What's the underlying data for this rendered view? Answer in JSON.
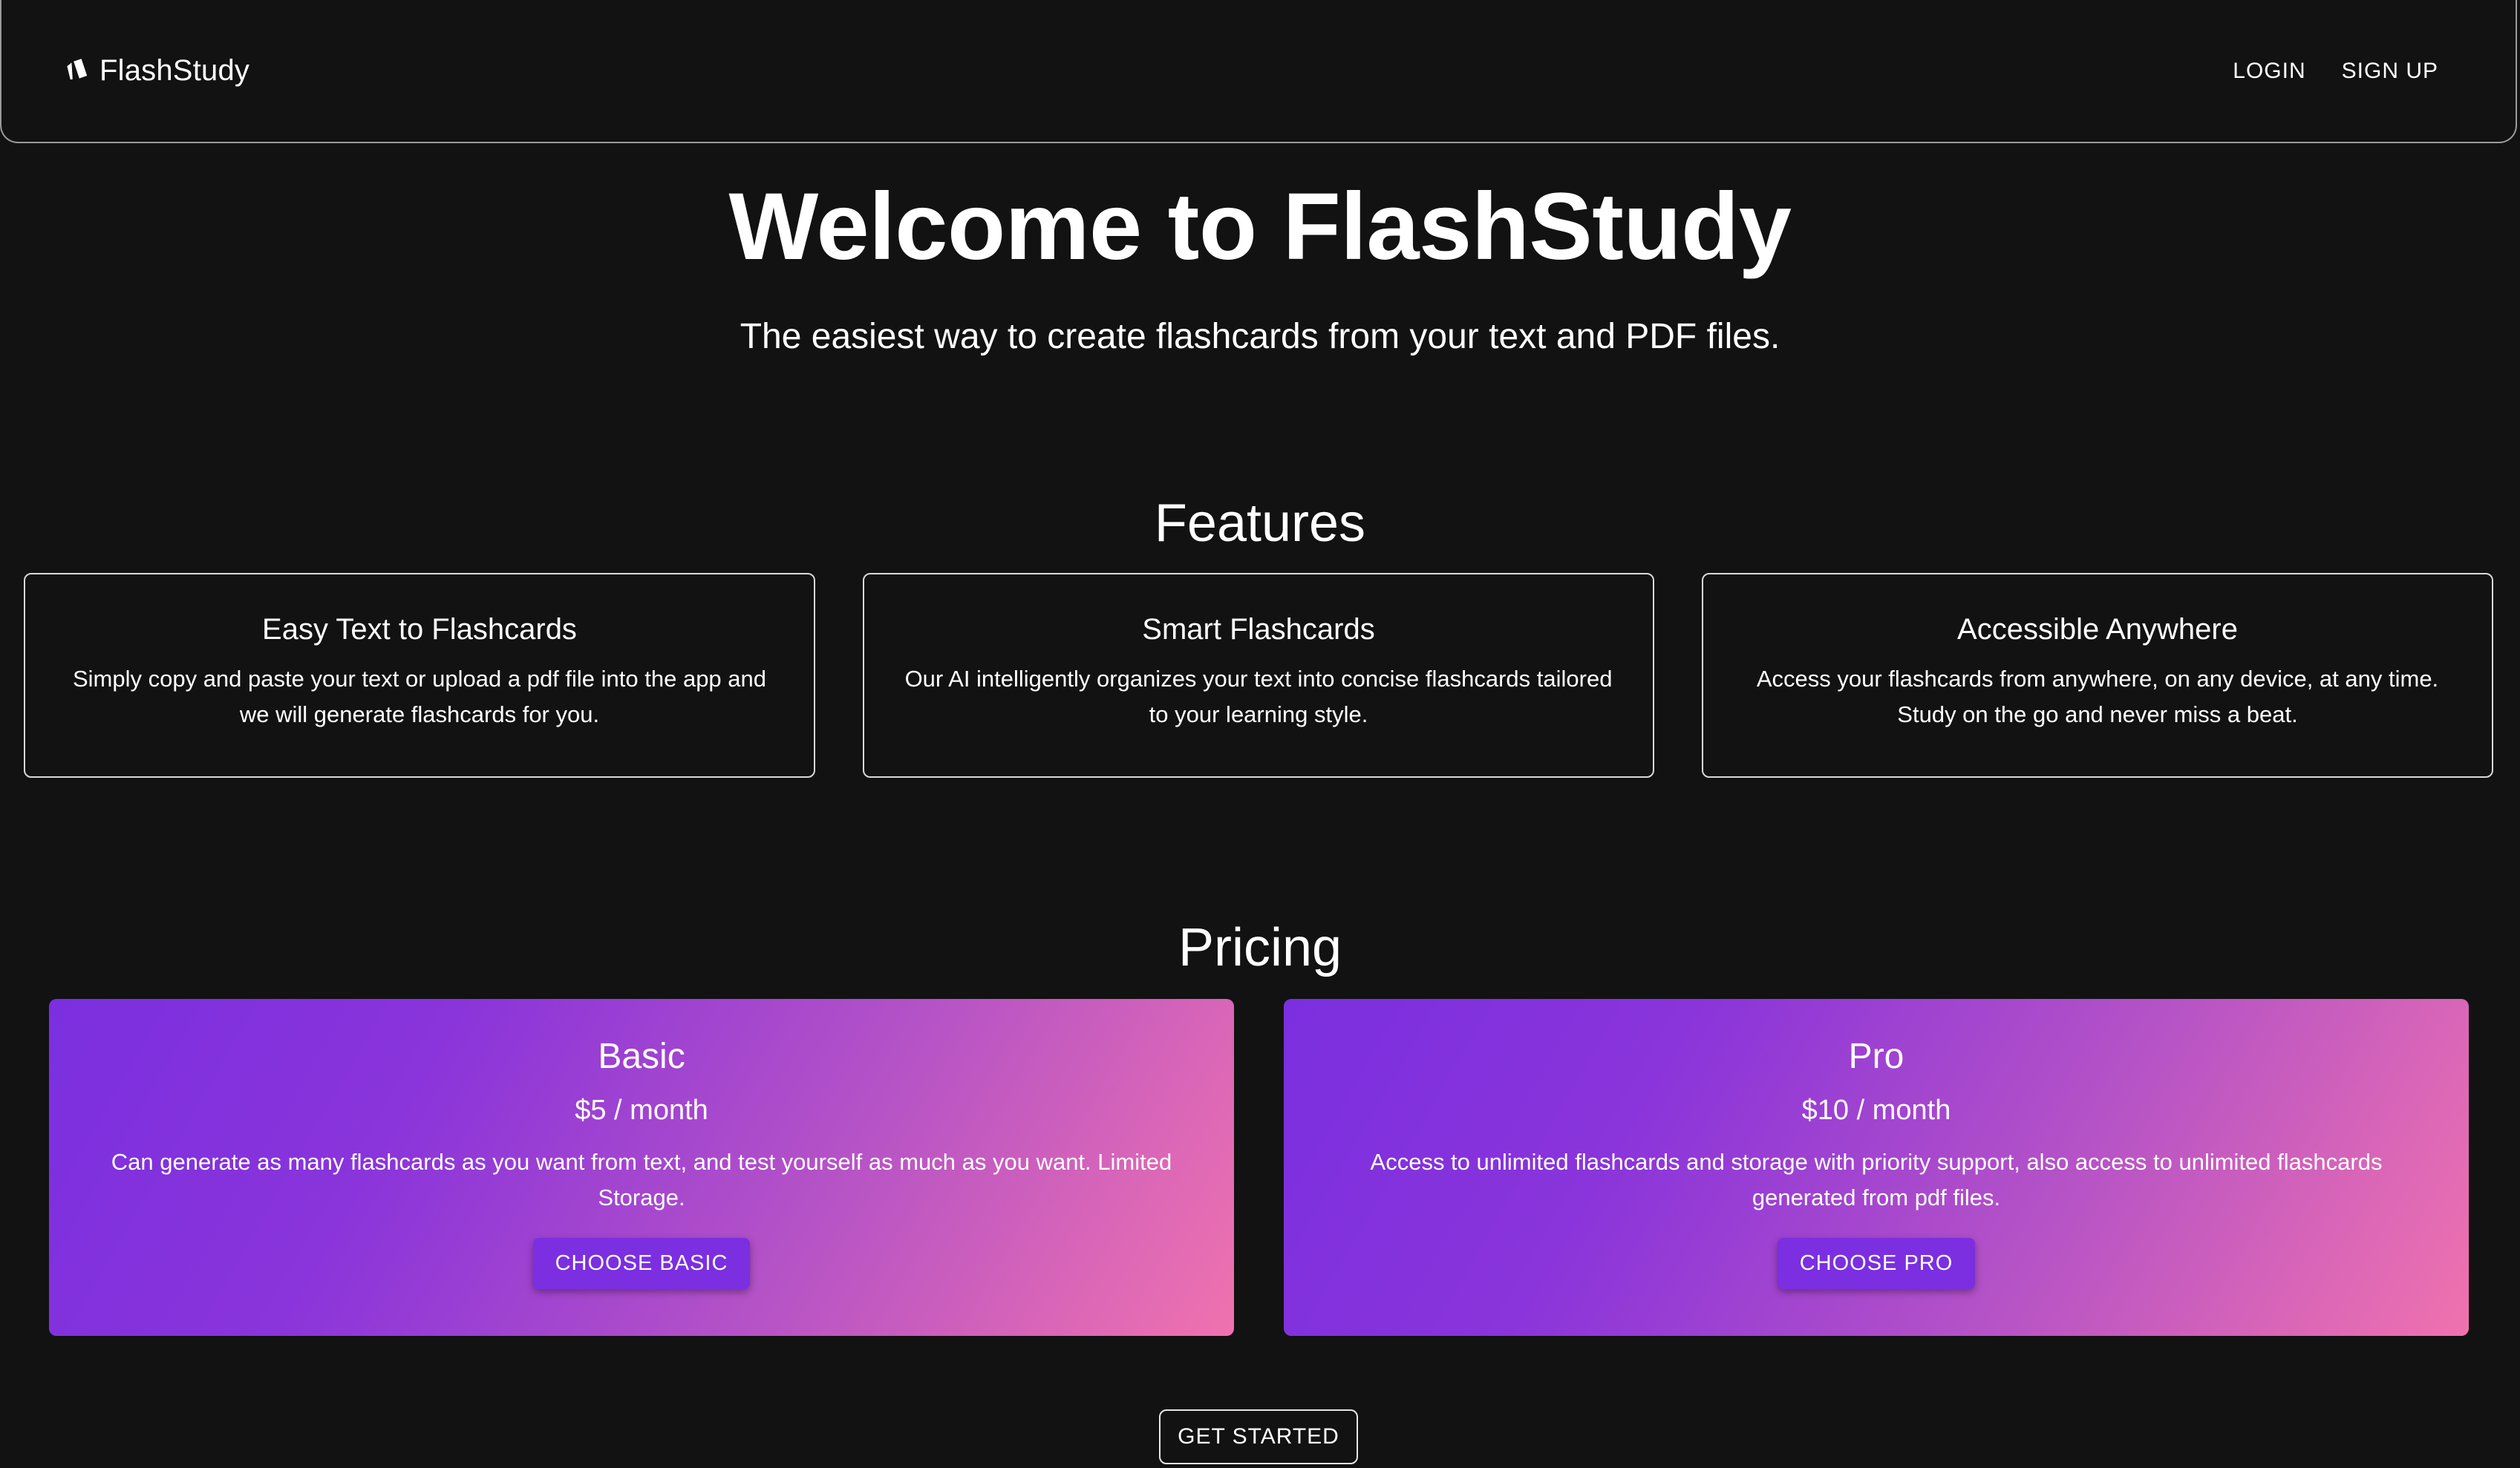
{
  "header": {
    "brand_icon": "flashcards-icon",
    "title": "FlashStudy",
    "login_label": "LOGIN",
    "signup_label": "SIGN UP"
  },
  "hero": {
    "title": "Welcome to FlashStudy",
    "subtitle": "The easiest way to create flashcards from your text and PDF files."
  },
  "features": {
    "title": "Features",
    "items": [
      {
        "title": "Easy Text to Flashcards",
        "description": "Simply copy and paste your text or upload a pdf file into the app and we will generate flashcards for you."
      },
      {
        "title": "Smart Flashcards",
        "description": "Our AI intelligently organizes your text into concise flashcards tailored to your learning style."
      },
      {
        "title": "Accessible Anywhere",
        "description": "Access your flashcards from anywhere, on any device, at any time. Study on the go and never miss a beat."
      }
    ]
  },
  "pricing": {
    "title": "Pricing",
    "plans": [
      {
        "name": "Basic",
        "price": "$5 / month",
        "description": "Can generate as many flashcards as you want from text, and test yourself as much as you want. Limited Storage.",
        "button_label": "CHOOSE BASIC"
      },
      {
        "name": "Pro",
        "price": "$10 / month",
        "description": "Access to unlimited flashcards and storage with priority support, also access to unlimited flashcards generated from pdf files.",
        "button_label": "CHOOSE PRO"
      }
    ]
  },
  "cta": {
    "label": "GET STARTED"
  },
  "colors": {
    "background": "#121212",
    "gradient_start": "#7b2fdf",
    "gradient_end": "#f072ae",
    "button_purple": "#7b2fe0"
  }
}
